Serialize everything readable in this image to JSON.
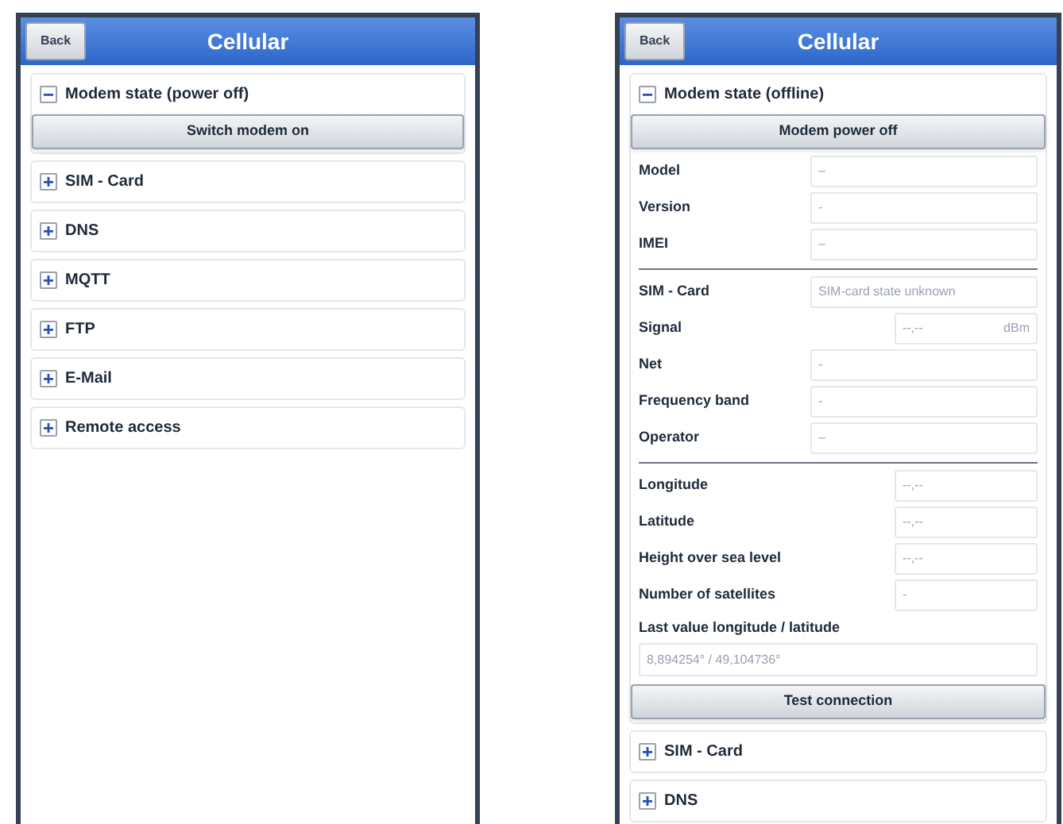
{
  "screens": [
    {
      "back": "Back",
      "title": "Cellular",
      "sections": [
        {
          "label": "Modem state (power off)",
          "expanded": true,
          "button": "Switch modem on"
        },
        {
          "label": "SIM - Card",
          "expanded": false
        },
        {
          "label": "DNS",
          "expanded": false
        },
        {
          "label": "MQTT",
          "expanded": false
        },
        {
          "label": "FTP",
          "expanded": false
        },
        {
          "label": "E-Mail",
          "expanded": false
        },
        {
          "label": "Remote access",
          "expanded": false
        }
      ]
    },
    {
      "back": "Back",
      "title": "Cellular",
      "sections": [
        {
          "label": "Modem state (offline)",
          "expanded": true,
          "button": "Modem power off",
          "field_groups": [
            [
              {
                "kind": "wide",
                "label": "Model",
                "value": "–"
              },
              {
                "kind": "wide",
                "label": "Version",
                "value": "-"
              },
              {
                "kind": "wide",
                "label": "IMEI",
                "value": "–"
              }
            ],
            [
              {
                "kind": "wide",
                "label": "SIM - Card",
                "value": "SIM-card state unknown"
              },
              {
                "kind": "short",
                "label": "Signal",
                "value": "--,--",
                "unit": "dBm"
              },
              {
                "kind": "wide",
                "label": "Net",
                "value": "-"
              },
              {
                "kind": "wide",
                "label": "Frequency band",
                "value": "-"
              },
              {
                "kind": "wide",
                "label": "Operator",
                "value": "–"
              }
            ],
            [
              {
                "kind": "short",
                "label": "Longitude",
                "value": "--,--"
              },
              {
                "kind": "short",
                "label": "Latitude",
                "value": "--,--"
              },
              {
                "kind": "short",
                "label": "Height over sea level",
                "value": "--,--"
              },
              {
                "kind": "short",
                "label": "Number of satellites",
                "value": "-"
              },
              {
                "kind": "stacked",
                "label": "Last value longitude / latitude",
                "value": "8,894254° / 49,104736°"
              }
            ]
          ],
          "footer_button": "Test connection"
        },
        {
          "label": "SIM - Card",
          "expanded": false
        },
        {
          "label": "DNS",
          "expanded": false
        }
      ]
    }
  ]
}
